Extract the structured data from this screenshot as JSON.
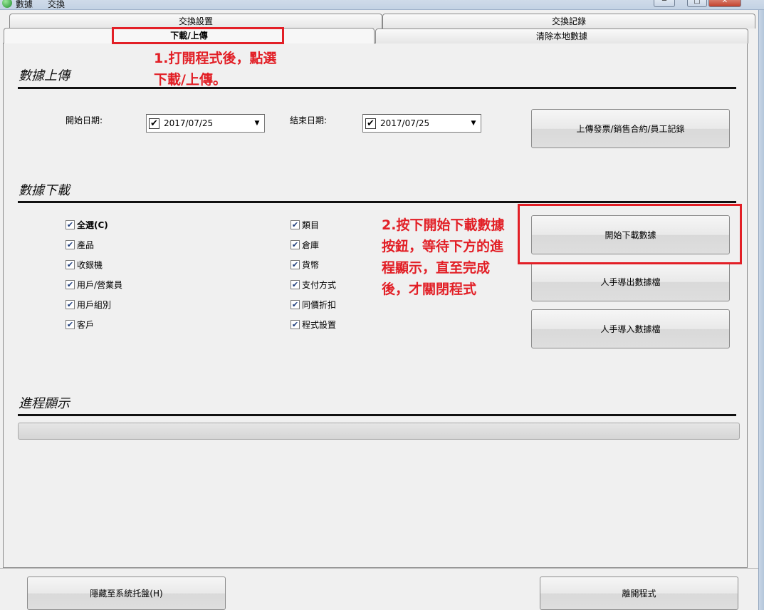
{
  "menu": {
    "items": [
      "數據",
      "交換"
    ]
  },
  "window_controls": {
    "minimize": "─",
    "maximize": "□",
    "close": "✕"
  },
  "tabs": {
    "row1": [
      "交換設置",
      "交換記錄"
    ],
    "row2": [
      "下載/上傳",
      "清除本地數據"
    ],
    "active": "下載/上傳"
  },
  "annotations": {
    "step1": [
      "1.打開程式後，點選",
      "下載/上傳。"
    ],
    "step2": [
      "2.按下開始下載數據",
      "按鈕，等待下方的進",
      "程顯示，直至完成",
      "後，才關閉程式"
    ]
  },
  "upload": {
    "title": "數據上傳",
    "start_label": "開始日期:",
    "start_value": "2017/07/25",
    "end_label": "結束日期:",
    "end_value": "2017/07/25",
    "upload_button": "上傳發票/銷售合約/員工記錄"
  },
  "download": {
    "title": "數據下載",
    "items_left": [
      "全選(C)",
      "產品",
      "收銀機",
      "用戶/營業員",
      "用戶組別",
      "客戶"
    ],
    "items_right": [
      "類目",
      "倉庫",
      "貨幣",
      "支付方式",
      "同價折扣",
      "程式設置"
    ],
    "checked": true,
    "start_button": "開始下載數據",
    "export_button": "人手導出數據檔",
    "import_button": "人手導入數據檔"
  },
  "progress": {
    "title": "進程顯示",
    "value": 0
  },
  "bottom": {
    "hide_button": "隱藏至系統托盤(H)",
    "exit_button": "離開程式"
  },
  "colors": {
    "annotation": "#e21f26",
    "background": "#f0f0f0"
  }
}
